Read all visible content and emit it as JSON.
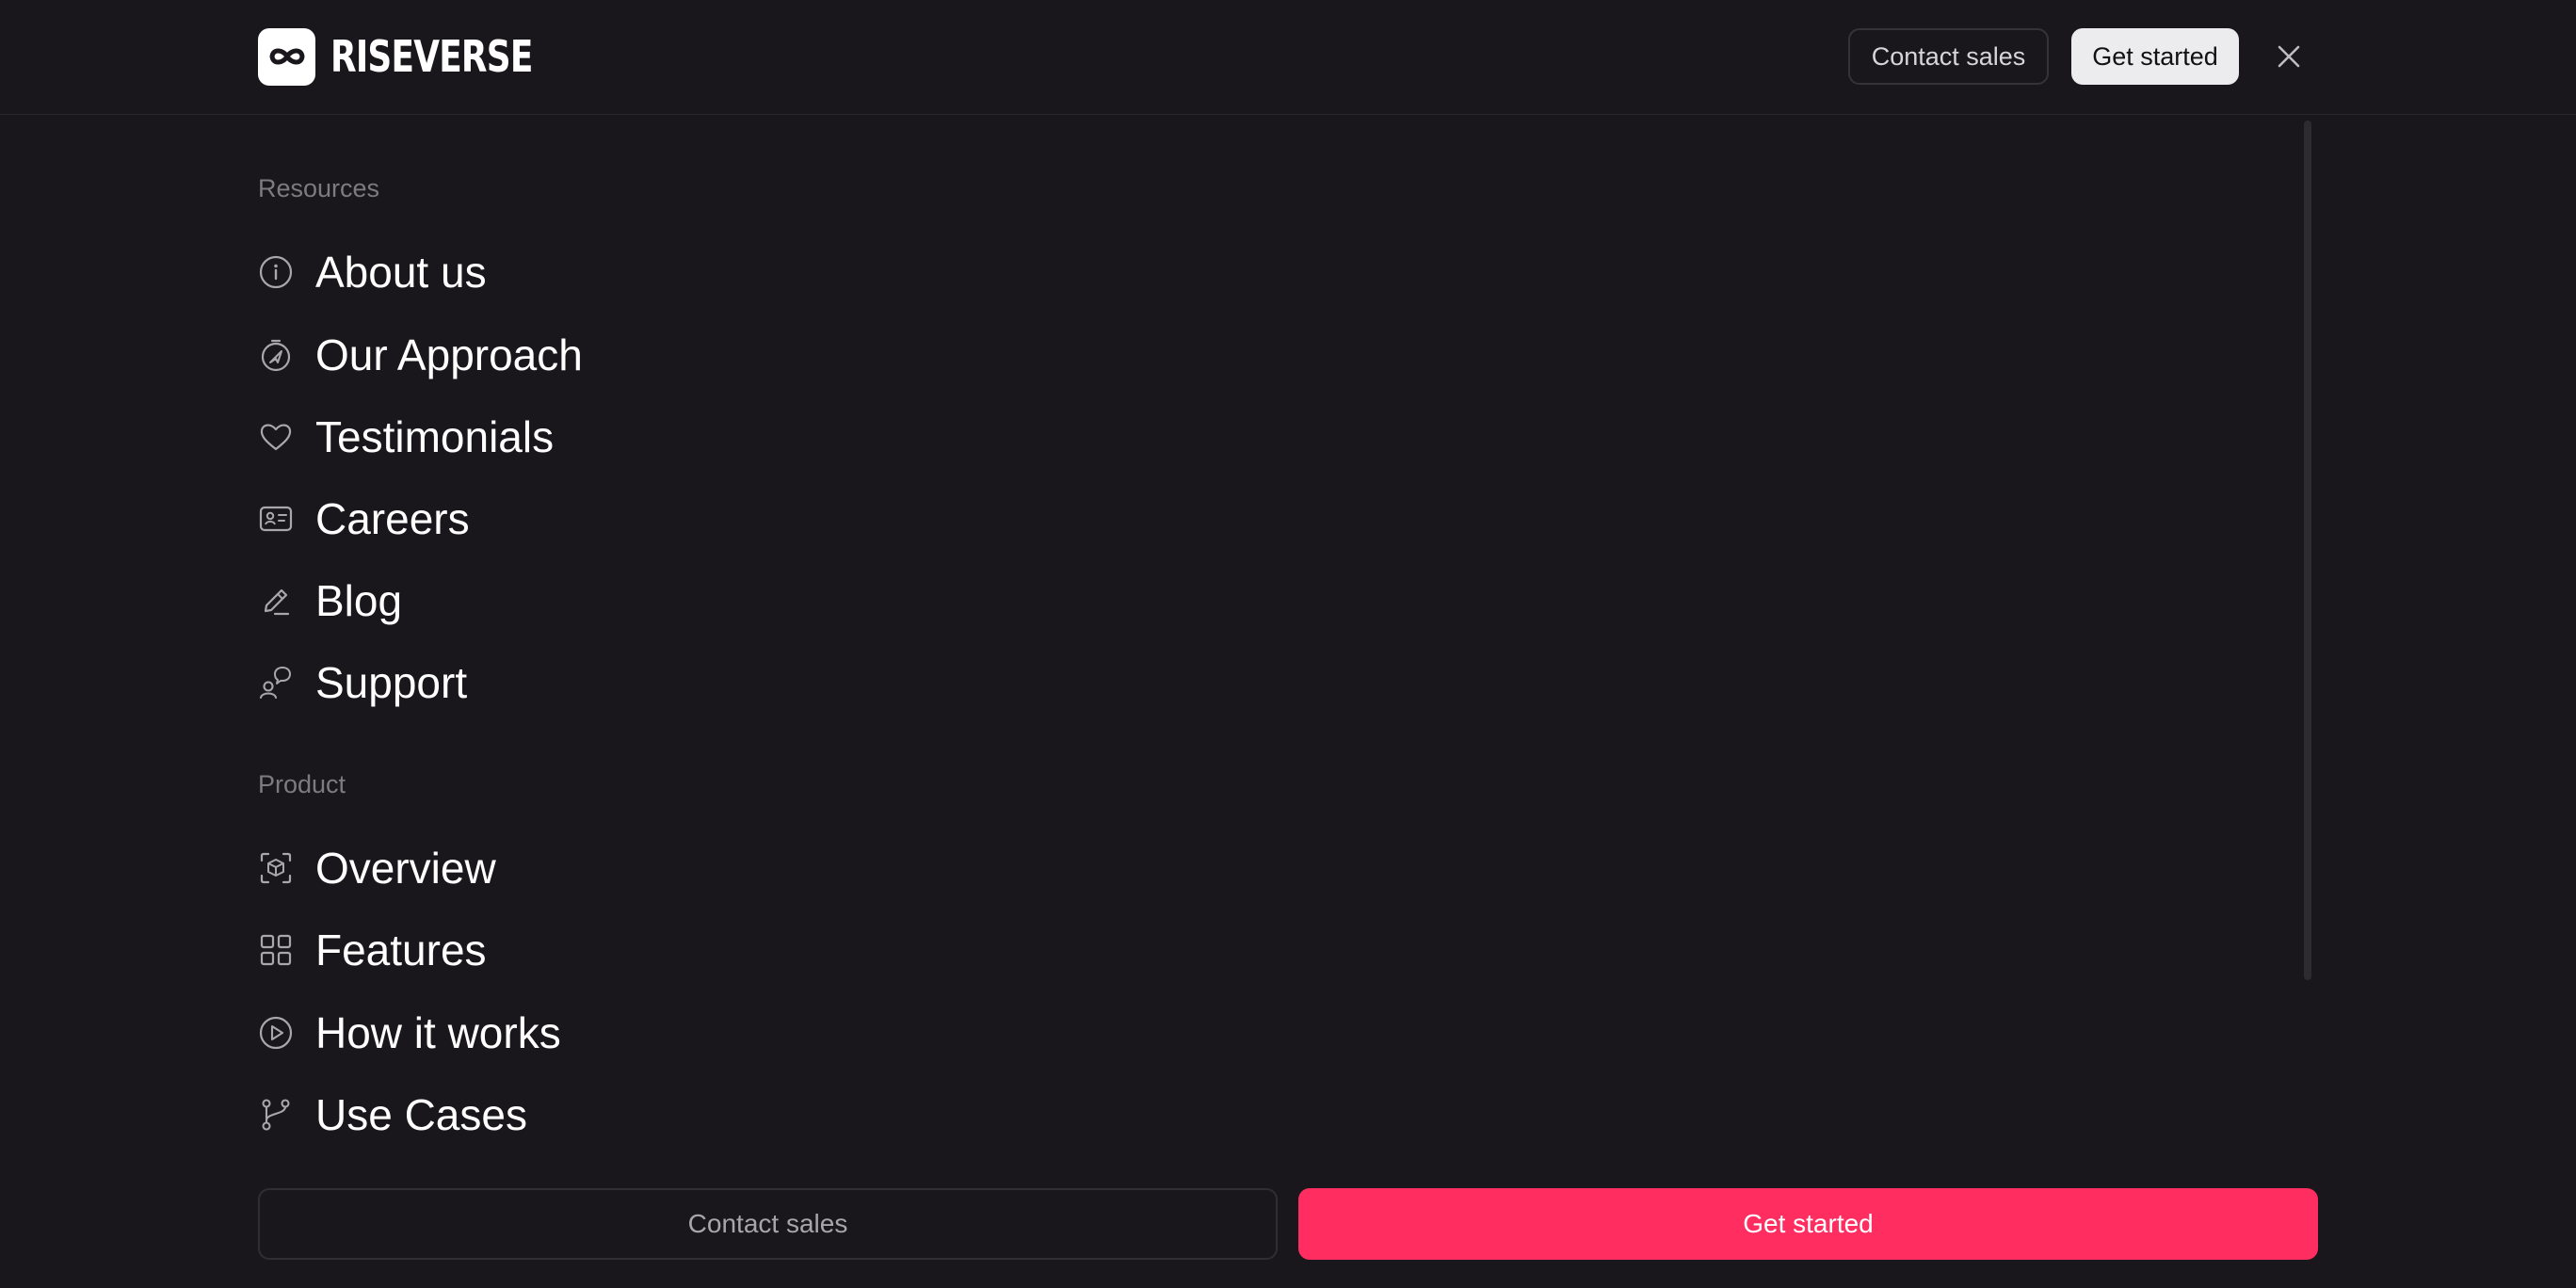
{
  "header": {
    "brand_name": "RISEVERSE",
    "logo_icon": "infinity-icon",
    "contact_sales_label": "Contact sales",
    "get_started_label": "Get started",
    "close_icon": "close-icon"
  },
  "menu": {
    "sections": [
      {
        "title": "Resources",
        "items": [
          {
            "label": "About us",
            "icon": "info-icon"
          },
          {
            "label": "Our Approach",
            "icon": "compass-icon"
          },
          {
            "label": "Testimonials",
            "icon": "heart-icon"
          },
          {
            "label": "Careers",
            "icon": "id-card-icon"
          },
          {
            "label": "Blog",
            "icon": "pencil-icon"
          },
          {
            "label": "Support",
            "icon": "user-chat-icon"
          }
        ]
      },
      {
        "title": "Product",
        "items": [
          {
            "label": "Overview",
            "icon": "scan-cube-icon"
          },
          {
            "label": "Features",
            "icon": "grid-icon"
          },
          {
            "label": "How it works",
            "icon": "play-circle-icon"
          },
          {
            "label": "Use Cases",
            "icon": "git-branch-icon"
          }
        ]
      }
    ]
  },
  "footer": {
    "contact_sales_label": "Contact sales",
    "get_started_label": "Get started"
  },
  "colors": {
    "background": "#19171b",
    "accent": "#ff2d60",
    "muted_text": "#7d7b82"
  }
}
